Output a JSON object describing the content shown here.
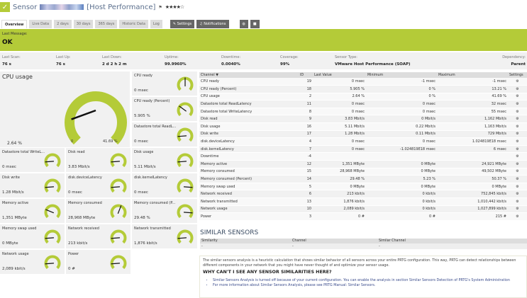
{
  "header": {
    "prefix": "Sensor",
    "name": "[Host Performance]",
    "flag_icon": "flag-icon",
    "stars": "★★★★☆",
    "rating": 4
  },
  "tabs": [
    "Overview",
    "Live Data",
    "2 days",
    "30 days",
    "365 days",
    "Historic Data",
    "Log"
  ],
  "actions": {
    "settings": "Settings",
    "notifications": "Notifications"
  },
  "banner": {
    "label": "Last Message:",
    "value": "OK",
    "color": "#b4cb38"
  },
  "stats": [
    {
      "label": "Last Scan:",
      "value": "76 s"
    },
    {
      "label": "Last Up:",
      "value": "76 s"
    },
    {
      "label": "Last Down:",
      "value": "2 d 2 h 2 m"
    },
    {
      "label": "Uptime:",
      "value": "99.9960%"
    },
    {
      "label": "Downtime:",
      "value": "0.0040%"
    },
    {
      "label": "Coverage:",
      "value": "99%"
    },
    {
      "label": "Sensor Type:",
      "value": "VMware Host Performance (SOAP)"
    },
    {
      "label": "Dependency:",
      "value": "Parent"
    }
  ],
  "main_gauge": {
    "name": "CPU usage",
    "value": "2.64 %",
    "min": "0",
    "max": "41.69 %",
    "fraction": 0.063
  },
  "gauges": [
    {
      "name": "CPU ready",
      "value": "0 msec",
      "fraction": 0.5
    },
    {
      "name": "CPU ready (Percent)",
      "value": "5.905 %",
      "fraction": 0.3
    },
    {
      "name": "Datastore total ReadL...",
      "value": "0 msec",
      "fraction": 0.15
    },
    {
      "name": "Datastore total WriteL...",
      "value": "0 msec",
      "fraction": 0.15
    },
    {
      "name": "Disk read",
      "value": "3.83 Mbit/s",
      "fraction": 0.15
    },
    {
      "name": "Disk usage",
      "value": "5.11 Mbit/s",
      "fraction": 0.15
    },
    {
      "name": "Disk write",
      "value": "1.28 Mbit/s",
      "fraction": 0.15
    },
    {
      "name": "disk.deviceLatency",
      "value": "0 msec",
      "fraction": 0.15
    },
    {
      "name": "disk.kernelLatency",
      "value": "0 msec",
      "fraction": 0.85
    },
    {
      "name": "Memory active",
      "value": "1,351 MByte",
      "fraction": 0.25
    },
    {
      "name": "Memory consumed",
      "value": "28,968 MByte",
      "fraction": 0.58
    },
    {
      "name": "Memory consumed (P...",
      "value": "29.48 %",
      "fraction": 0.85
    },
    {
      "name": "Memory swap used",
      "value": "0 MByte",
      "fraction": 0.15
    },
    {
      "name": "Network received",
      "value": "213 kbit/s",
      "fraction": 0.15
    },
    {
      "name": "Network transmitted",
      "value": "1,876 kbit/s",
      "fraction": 0.15
    },
    {
      "name": "Network usage",
      "value": "2,089 kbit/s",
      "fraction": 0.15
    },
    {
      "name": "Power",
      "value": "0 #",
      "fraction": 0.15
    }
  ],
  "channels": {
    "headers": [
      "Channel ▼",
      "ID",
      "Last Value",
      "Minimum",
      "Maximum",
      "Settings"
    ],
    "rows": [
      [
        "CPU ready",
        "19",
        "0 msec",
        "-1 msec",
        "-1 msec"
      ],
      [
        "CPU ready (Percent)",
        "18",
        "5.905 %",
        "0 %",
        "13.21 %"
      ],
      [
        "CPU usage",
        "2",
        "2.64 %",
        "0 %",
        "41.69 %"
      ],
      [
        "Datastore total ReadLatency",
        "11",
        "0 msec",
        "0 msec",
        "32 msec"
      ],
      [
        "Datastore total WriteLatency",
        "8",
        "0 msec",
        "0 msec",
        "55 msec"
      ],
      [
        "Disk read",
        "9",
        "3.83 Mbit/s",
        "0 Mbit/s",
        "1,162 Mbit/s"
      ],
      [
        "Disk usage",
        "16",
        "5.11 Mbit/s",
        "0.22 Mbit/s",
        "1,163 Mbit/s"
      ],
      [
        "Disk write",
        "17",
        "1.28 Mbit/s",
        "0.11 Mbit/s",
        "729 Mbit/s"
      ],
      [
        "disk.deviceLatency",
        "4",
        "0 msec",
        "0 msec",
        "1.024819E18 msec"
      ],
      [
        "disk.kernelLatency",
        "7",
        "0 msec",
        "-1.024819E18 msec",
        "6 msec"
      ],
      [
        "Downtime",
        "-4",
        "",
        "",
        ""
      ],
      [
        "Memory active",
        "12",
        "1,351 MByte",
        "0 MByte",
        "24,921 MByte"
      ],
      [
        "Memory consumed",
        "15",
        "28,968 MByte",
        "0 MByte",
        "49,502 MByte"
      ],
      [
        "Memory consumed (Percent)",
        "14",
        "29.48 %",
        "5.23 %",
        "50.37 %"
      ],
      [
        "Memory swap used",
        "5",
        "0 MByte",
        "0 MByte",
        "0 MByte"
      ],
      [
        "Network received",
        "6",
        "213 kbit/s",
        "0 kbit/s",
        "752,845 kbit/s"
      ],
      [
        "Network transmitted",
        "13",
        "1,876 kbit/s",
        "0 kbit/s",
        "1,010,442 kbit/s"
      ],
      [
        "Network usage",
        "10",
        "2,089 kbit/s",
        "0 kbit/s",
        "1,027,899 kbit/s"
      ],
      [
        "Power",
        "3",
        "0 #",
        "0 #",
        "215 #"
      ]
    ]
  },
  "similar": {
    "title": "SIMILAR SENSORS",
    "headers": [
      "Similarity",
      "Channel",
      "Similar Channel"
    ],
    "row": [
      "-",
      "-",
      "-"
    ]
  },
  "info": {
    "text": "The similar sensors analysis is a heuristic calculation that shows similar behavior of all sensors across your entire PRTG configuration. This way, PRTG can detect relationships between different components in your network that you might have never thought of and optimize your sensor usage.",
    "heading": "WHY CAN'T I SEE ANY SENSOR SIMILARITIES HERE?",
    "bullets": [
      "Similar Sensors Analysis is turned off because of your current configuration. You can enable the analysis in section Similar Sensors Detection of PRTG's System Administration",
      "For more information about Similar Sensors Analysis, please see PRTG Manual: Similar Sensors."
    ]
  }
}
